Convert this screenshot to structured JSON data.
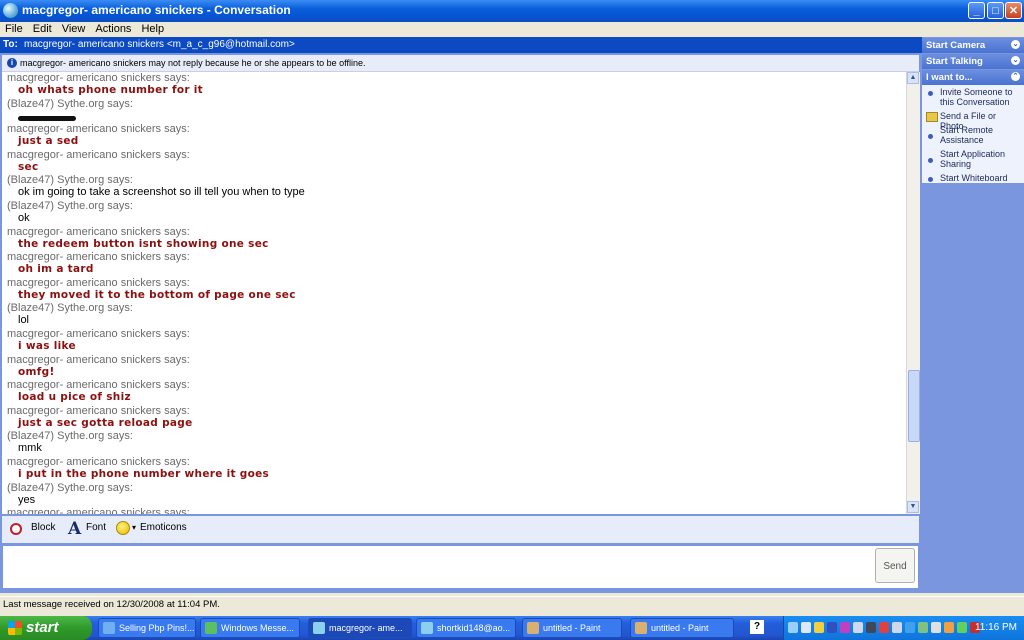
{
  "window": {
    "title": "macgregor- americano snickers - Conversation",
    "controls": {
      "minimize": "_",
      "maximize": "□",
      "close": "✕"
    }
  },
  "menu": [
    "File",
    "Edit",
    "View",
    "Actions",
    "Help"
  ],
  "to_bar": {
    "label": "To:",
    "contact": "macgregor- americano snickers <m_a_c_g96@hotmail.com>"
  },
  "info_bar": {
    "icon": "i",
    "text": "macgregor- americano snickers may not reply because he or she appears to be offline."
  },
  "messages": [
    {
      "sender": "macgregor- americano snickers says:",
      "text": "oh whats phone number for it",
      "style": "red"
    },
    {
      "sender": "(Blaze47) Sythe.org says:",
      "text": "",
      "style": "black",
      "redacted": true
    },
    {
      "sender": "macgregor- americano snickers says:",
      "text": "just a sed",
      "style": "red"
    },
    {
      "sender": "macgregor- americano snickers says:",
      "text": "sec",
      "style": "red"
    },
    {
      "sender": "(Blaze47) Sythe.org says:",
      "text": "ok im going to take a screenshot so ill tell you when to type",
      "style": "black"
    },
    {
      "sender": "(Blaze47) Sythe.org says:",
      "text": "ok",
      "style": "black"
    },
    {
      "sender": "macgregor- americano snickers says:",
      "text": "the redeem button isnt showing one sec",
      "style": "red"
    },
    {
      "sender": "macgregor- americano snickers says:",
      "text": "oh im a tard",
      "style": "red"
    },
    {
      "sender": "macgregor- americano snickers says:",
      "text": "they moved it to the bottom of page one sec",
      "style": "red"
    },
    {
      "sender": "(Blaze47) Sythe.org says:",
      "text": "lol",
      "style": "black"
    },
    {
      "sender": "macgregor- americano snickers says:",
      "text": "i was like",
      "style": "red"
    },
    {
      "sender": "macgregor- americano snickers says:",
      "text": "omfg!",
      "style": "red"
    },
    {
      "sender": "macgregor- americano snickers says:",
      "text": "load u pice of shiz",
      "style": "red"
    },
    {
      "sender": "macgregor- americano snickers says:",
      "text": "just a sec gotta reload page",
      "style": "red"
    },
    {
      "sender": "(Blaze47) Sythe.org says:",
      "text": "mmk",
      "style": "black"
    },
    {
      "sender": "macgregor- americano snickers says:",
      "text": "i put in the phone number where it goes",
      "style": "red"
    },
    {
      "sender": "(Blaze47) Sythe.org says:",
      "text": "yes",
      "style": "black"
    },
    {
      "sender": "macgregor- americano snickers says:",
      "text": "",
      "style": "black"
    }
  ],
  "toolbar": {
    "block": "Block",
    "font": "Font",
    "font_glyph": "A",
    "emoticons": "Emoticons",
    "emoticons_arrow": "▾"
  },
  "send_label": "Send",
  "sidebar": {
    "sections": [
      "Start Camera",
      "Start Talking",
      "I want to..."
    ],
    "items": [
      "Invite Someone to this Conversation",
      "Send a File or Photo",
      "Start Remote Assistance",
      "Start Application Sharing",
      "Start Whiteboard"
    ]
  },
  "status": "Last message received on 12/30/2008 at 11:04 PM.",
  "taskbar": {
    "start": "start",
    "tasks": [
      "Selling Pbp Pins!...",
      "Windows Messe...",
      "macgregor- ame...",
      "shortkid148@ao...",
      "untitled - Paint",
      "untitled - Paint"
    ],
    "help": "?",
    "clock": "11:16 PM"
  }
}
